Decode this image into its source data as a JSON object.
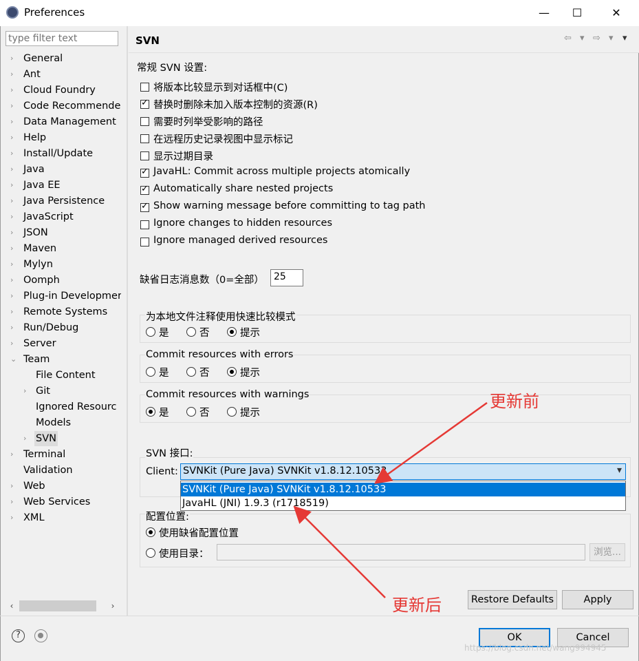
{
  "window": {
    "title": "Preferences",
    "minimize_glyph": "—",
    "maximize_glyph": "☐",
    "close_glyph": "✕"
  },
  "sidebar": {
    "filter_placeholder": "type filter text",
    "items": [
      {
        "label": "General",
        "arrow": "›"
      },
      {
        "label": "Ant",
        "arrow": "›"
      },
      {
        "label": "Cloud Foundry",
        "arrow": "›"
      },
      {
        "label": "Code Recommende",
        "arrow": "›"
      },
      {
        "label": "Data Management",
        "arrow": "›"
      },
      {
        "label": "Help",
        "arrow": "›"
      },
      {
        "label": "Install/Update",
        "arrow": "›"
      },
      {
        "label": "Java",
        "arrow": "›"
      },
      {
        "label": "Java EE",
        "arrow": "›"
      },
      {
        "label": "Java Persistence",
        "arrow": "›"
      },
      {
        "label": "JavaScript",
        "arrow": "›"
      },
      {
        "label": "JSON",
        "arrow": "›"
      },
      {
        "label": "Maven",
        "arrow": "›"
      },
      {
        "label": "Mylyn",
        "arrow": "›"
      },
      {
        "label": "Oomph",
        "arrow": "›"
      },
      {
        "label": "Plug-in Developmer",
        "arrow": "›"
      },
      {
        "label": "Remote Systems",
        "arrow": "›"
      },
      {
        "label": "Run/Debug",
        "arrow": "›"
      },
      {
        "label": "Server",
        "arrow": "›"
      },
      {
        "label": "Team",
        "arrow": "⌄"
      },
      {
        "label": "File Content",
        "arrow": ""
      },
      {
        "label": "Git",
        "arrow": "›"
      },
      {
        "label": "Ignored Resourc",
        "arrow": ""
      },
      {
        "label": "Models",
        "arrow": ""
      },
      {
        "label": "SVN",
        "arrow": "›"
      },
      {
        "label": "Terminal",
        "arrow": "›"
      },
      {
        "label": "Validation",
        "arrow": ""
      },
      {
        "label": "Web",
        "arrow": "›"
      },
      {
        "label": "Web Services",
        "arrow": "›"
      },
      {
        "label": "XML",
        "arrow": "›"
      }
    ],
    "selected": "SVN",
    "scroll_left": "‹",
    "scroll_right": "›"
  },
  "page": {
    "title": "SVN",
    "nav_back": "⇦",
    "nav_fwd": "⇨",
    "nav_drop": "▾",
    "section_general": "常规 SVN 设置:",
    "checkboxes": [
      {
        "label": "将版本比较显示到对话框中(C)",
        "checked": false
      },
      {
        "label": "替换时删除未加入版本控制的资源(R)",
        "checked": true
      },
      {
        "label": "需要时列举受影响的路径",
        "checked": false
      },
      {
        "label": "在远程历史记录视图中显示标记",
        "checked": false
      },
      {
        "label": "显示过期目录",
        "checked": false
      },
      {
        "label": "JavaHL: Commit across multiple projects atomically",
        "checked": true
      },
      {
        "label": "Automatically share nested projects",
        "checked": true
      },
      {
        "label": "Show warning message before committing to tag path",
        "checked": true
      },
      {
        "label": "Ignore changes to hidden resources",
        "checked": false
      },
      {
        "label": "Ignore managed derived resources",
        "checked": false
      }
    ],
    "log_label": "缺省日志消息数（0=全部）",
    "log_value": "25",
    "groups": [
      {
        "title": "为本地文件注释使用快速比较模式",
        "options": [
          "是",
          "否",
          "提示"
        ],
        "selected": 2
      },
      {
        "title": "Commit resources with errors",
        "options": [
          "是",
          "否",
          "提示"
        ],
        "selected": 2
      },
      {
        "title": "Commit resources with warnings",
        "options": [
          "是",
          "否",
          "提示"
        ],
        "selected": 0
      }
    ],
    "interface_title": "SVN 接口:",
    "client_label": "Client:",
    "client_value": "SVNKit (Pure Java) SVNKit v1.8.12.10533",
    "client_options": [
      "SVNKit (Pure Java) SVNKit v1.8.12.10533",
      "JavaHL (JNI) 1.9.3 (r1718519)"
    ],
    "config_title": "配置位置:",
    "config_default": "使用缺省配置位置",
    "config_dir": "使用目录：",
    "browse_label": "浏览...",
    "restore_label": "Restore Defaults",
    "apply_label": "Apply"
  },
  "footer": {
    "ok_label": "OK",
    "cancel_label": "Cancel",
    "help_glyph": "?",
    "watermark": "https://blog.csdn.net/wang994945"
  },
  "annotations": {
    "before": "更新前",
    "after": "更新后",
    "color": "#e53935"
  }
}
